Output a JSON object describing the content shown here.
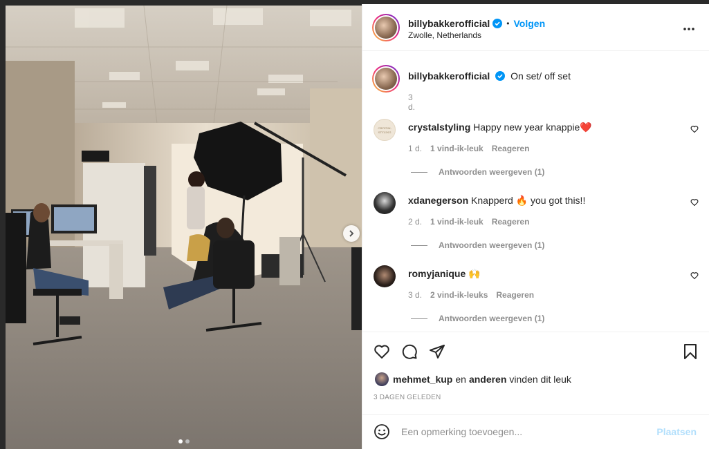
{
  "post": {
    "account": "billybakkerofficial",
    "location": "Zwolle, Netherlands",
    "follow_label": "Volgen",
    "bullet": "•",
    "caption": "On set/ off set",
    "caption_time": "3 d.",
    "likes_user": "mehmet_kup",
    "likes_connector": "en",
    "likes_others": "anderen",
    "likes_suffix": "vinden dit leuk",
    "date": "3 DAGEN GELEDEN",
    "carousel_total": 2,
    "carousel_active": 1
  },
  "comments": [
    {
      "user": "crystalstyling",
      "text": "Happy new year knappie❤️",
      "time": "1 d.",
      "likes": "1 vind-ik-leuk",
      "reply_label": "Reageren",
      "view_replies": "Antwoorden weergeven (1)"
    },
    {
      "user": "xdanegerson",
      "text": "Knapperd 🔥 you got this!!",
      "time": "2 d.",
      "likes": "1 vind-ik-leuk",
      "reply_label": "Reageren",
      "view_replies": "Antwoorden weergeven (1)"
    },
    {
      "user": "romyjanique",
      "text": "🙌",
      "time": "3 d.",
      "likes": "2 vind-ik-leuks",
      "reply_label": "Reageren",
      "view_replies": "Antwoorden weergeven (1)"
    }
  ],
  "composer": {
    "placeholder": "Een opmerking toevoegen...",
    "post_label": "Plaatsen"
  },
  "colors": {
    "link_blue": "#0095f6",
    "post_disabled": "#b2dffc",
    "muted": "#8e8e8e"
  },
  "icons": [
    "more-options-icon",
    "verified-badge-icon",
    "heart-icon",
    "comment-icon",
    "share-icon",
    "save-icon",
    "emoji-icon",
    "chevron-right-icon"
  ]
}
